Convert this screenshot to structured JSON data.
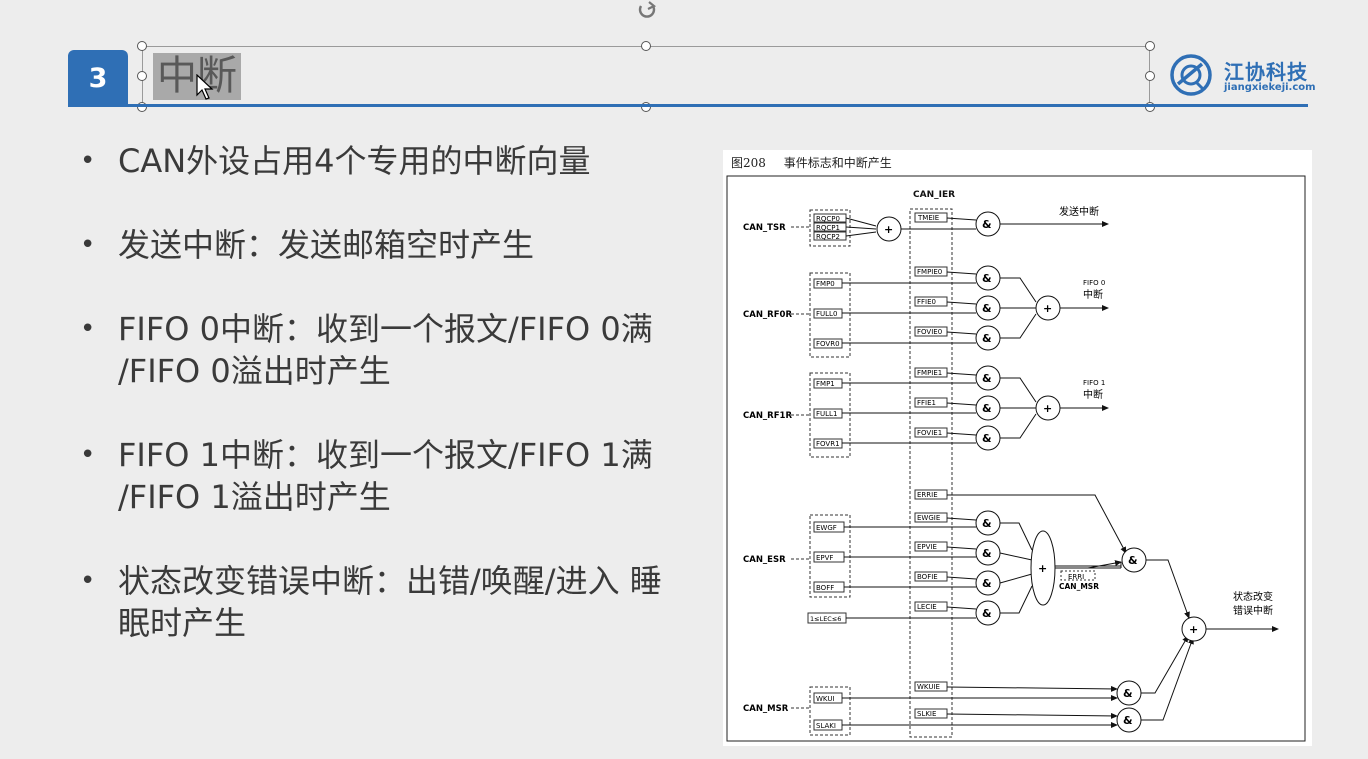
{
  "slide": {
    "number": "3",
    "title": "中断",
    "logo_name": "江协科技",
    "logo_url": "jiangxiekeji.com"
  },
  "bullets": [
    "CAN外设占用4个专用的中断向量",
    "发送中断：发送邮箱空时产生",
    "FIFO 0中断：收到一个报文/FIFO 0满 /FIFO 0溢出时产生",
    "FIFO 1中断：收到一个报文/FIFO 1满 /FIFO 1溢出时产生",
    "状态改变错误中断：出错/唤醒/进入 睡眠时产生"
  ],
  "figure": {
    "number": "图208",
    "title": "事件标志和中断产生",
    "ier_label": "CAN_IER",
    "tsr": {
      "reg": "CAN_TSR",
      "flags": [
        "RQCP0",
        "RQCP1",
        "RQCP2"
      ],
      "enable": "TMEIE",
      "out": "发送中断"
    },
    "rf0r": {
      "reg": "CAN_RF0R",
      "flags": [
        "FMP0",
        "FULL0",
        "FOVR0"
      ],
      "enables": [
        "FMPIE0",
        "FFIE0",
        "FOVIE0"
      ],
      "out1": "FIFO 0",
      "out2": "中断"
    },
    "rf1r": {
      "reg": "CAN_RF1R",
      "flags": [
        "FMP1",
        "FULL1",
        "FOVR1"
      ],
      "enables": [
        "FMPIE1",
        "FFIE1",
        "FOVIE1"
      ],
      "out1": "FIFO 1",
      "out2": "中断"
    },
    "esr": {
      "reg": "CAN_ESR",
      "flags": [
        "EWGF",
        "EPVF",
        "BOFF",
        "1≤LEC≤6"
      ],
      "errie": "ERRIE",
      "enables": [
        "EWGIE",
        "EPVIE",
        "BOFIE",
        "LECIE"
      ],
      "erri": "ERRI",
      "msr": "CAN_MSR"
    },
    "msr": {
      "reg": "CAN_MSR",
      "flags": [
        "WKUI",
        "SLAKI"
      ],
      "enables": [
        "WKUIE",
        "SLKIE"
      ]
    },
    "status_out1": "状态改变",
    "status_out2": "错误中断",
    "and_symbol": "&",
    "or_symbol": "+"
  }
}
